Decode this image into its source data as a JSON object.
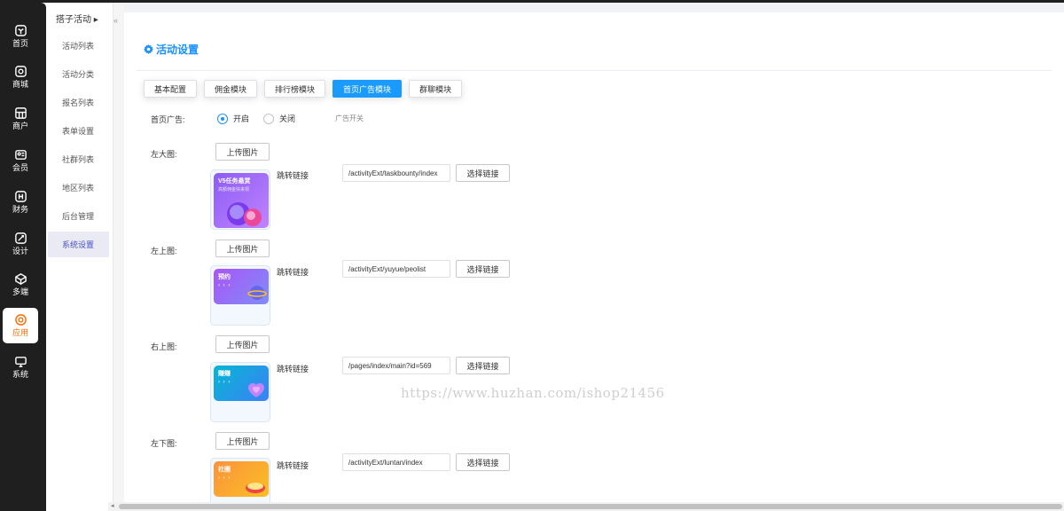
{
  "iconbar": {
    "items": [
      {
        "label": "首页",
        "icon": "cube-icon",
        "active": false
      },
      {
        "label": "商城",
        "icon": "shop-icon",
        "active": false
      },
      {
        "label": "商户",
        "icon": "store-icon",
        "active": false
      },
      {
        "label": "会员",
        "icon": "member-card-icon",
        "active": false
      },
      {
        "label": "财务",
        "icon": "finance-icon",
        "active": false
      },
      {
        "label": "设计",
        "icon": "design-icon",
        "active": false
      },
      {
        "label": "多端",
        "icon": "multi-platform-icon",
        "active": false
      },
      {
        "label": "应用",
        "icon": "app-icon",
        "active": true
      },
      {
        "label": "系统",
        "icon": "monitor-icon",
        "active": false
      }
    ]
  },
  "subnav": {
    "title": "搭子活动 ▸",
    "items": [
      "活动列表",
      "活动分类",
      "报名列表",
      "表单设置",
      "社群列表",
      "地区列表",
      "后台管理",
      "系统设置"
    ],
    "active_index": 7
  },
  "panel": {
    "title": "活动设置",
    "tabs": [
      "基本配置",
      "佣金模块",
      "排行榜模块",
      "首页广告模块",
      "群聊模块"
    ],
    "active_tab": 3
  },
  "form": {
    "ad_label": "首页广告:",
    "radio_on": "开启",
    "radio_off": "关闭",
    "hint": "广告开关",
    "upload_label": "上传图片",
    "link_label": "跳转链接",
    "select_link_label": "选择链接",
    "rows": [
      {
        "label": "左大图:",
        "thumb_title": "V5任务悬赏",
        "thumb_sub": "高额佣金快来领",
        "link": "/activityExt/taskbounty/index"
      },
      {
        "label": "左上图:",
        "thumb_title": "预约",
        "thumb_arrows": "› › ›",
        "link": "/activityExt/yuyue/peolist"
      },
      {
        "label": "右上图:",
        "thumb_title": "赚赚",
        "thumb_arrows": "› › ›",
        "link": "/pages/index/main?id=569"
      },
      {
        "label": "左下图:",
        "thumb_title": "社圈",
        "thumb_arrows": "› › ›",
        "link": "/activityExt/luntan/index"
      }
    ]
  },
  "watermark": "https://www.huzhan.com/ishop21456",
  "colors": {
    "accent": "#1a9bfc",
    "active_app": "#ff6a00",
    "sidebar_bg": "#1f1f1f"
  }
}
